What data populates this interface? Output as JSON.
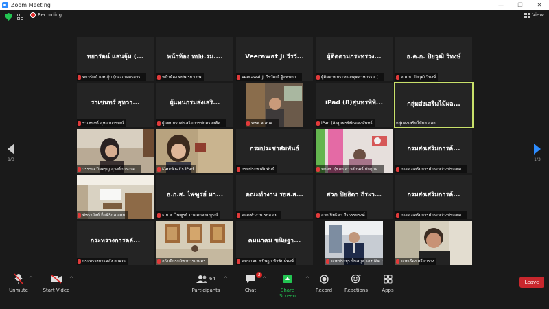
{
  "window": {
    "title": "Zoom Meeting",
    "minimize": "—",
    "maximize": "❐",
    "close": "✕"
  },
  "topbar": {
    "recording_label": "Recording",
    "view_label": "View"
  },
  "nav": {
    "prev_page": "1/3",
    "next_page": "1/3"
  },
  "tiles": [
    {
      "big": "ทยารัตน์ แสนจุ้ม (...",
      "caption": "ทยารัตน์ แสนจุ้ม (กองเกษตรสาร..."
    },
    {
      "big": "หน้าห้อง ทปษ.รม....",
      "caption": "หน้าห้อง ทปษ.รมว.กษ"
    },
    {
      "big": "Veerawat Ji วีรวั...",
      "caption": "Veerawat Ji วีรวัฒน์ ผู้แทนกา..."
    },
    {
      "big": "ผู้ติดตามกระทรวง...",
      "caption": "ผู้ติดตามกระทรวงอุตสาหกรรม (..."
    },
    {
      "big": "อ.ค.ก. ปิยวุฒิ วิทงษ์",
      "caption": "อ.ค.ก. ปิยวุฒิ วิทงษ์"
    },
    {
      "big": "ราเชนทร์ สุหวา...",
      "caption": "ราเชนทร์ สุหวานารมณ์"
    },
    {
      "big": "ผู้แทนกรมส่งเสริ...",
      "caption": "ผู้แทนกรมส่งเสริมการปกครองท้อ..."
    },
    {
      "big": "",
      "caption": "ทชพ.ศ.สนศ..."
    },
    {
      "big": "iPad (8)สุนทรพิพิ...",
      "caption": "iPad (8)สุนทรพิพิธแสงจันทร์"
    },
    {
      "big": "กลุ่มส่งเสริมไม้ผล...",
      "caption": "กลุ่มส่งเสริมไม้ผล สสจ."
    },
    {
      "big": "",
      "caption": "วรรรณ ปิดจรุญ สุวงค์การเกษ..."
    },
    {
      "big": "",
      "caption": "Kanokrat's iPad"
    },
    {
      "big": "กรมประชาสัมพันธ์",
      "caption": "กรมประชาสัมพันธ์"
    },
    {
      "big": "",
      "caption": "มกอช. (ชอก.สาวลักษณ์ ยักฤกษ..."
    },
    {
      "big": "กรมส่งเสริมการค้...",
      "caption": "กรมส่งเสริมการค้าระหว่างประเทศ..."
    },
    {
      "big": "",
      "caption": "พัชราวัลย์ ก็นศิริกุล สศก."
    },
    {
      "big": "ธ.ก.ส. ไพฑูรย์ มา...",
      "caption": "ธ.ก.ส. ไพฑูรย์ มาแตกจสมบูรณ์"
    },
    {
      "big": "คณะทำงาน รธส.ส...",
      "caption": "คณะทำงาน รธส.สม."
    },
    {
      "big": "สวก ปิยธิดา ถีระว...",
      "caption": "สวก ปิยธิดา ถีรธรรมรงค์"
    },
    {
      "big": "กรมส่งเสริมการค้...",
      "caption": "กรมส่งเสริมการค้าระหว่างประเทศ..."
    },
    {
      "big": "กระทรวงการคลั...",
      "caption": "กระทรวงการคลัง สาคุณ"
    },
    {
      "big": "",
      "caption": "อธิบดีกรมวิชาการเกษตร"
    },
    {
      "big": "คมนาคม ขนิษฐา...",
      "caption": "คมนาคม ขนิษฐา ห้าพันธ์พงษ์"
    },
    {
      "big": "",
      "caption": "นายประยุร ปั้นสกุล รองปลัด กษ."
    },
    {
      "big": "",
      "caption": "นายเรือง ศรีนาราง"
    }
  ],
  "toolbar": {
    "unmute": "Unmute",
    "start_video": "Start Video",
    "participants": "Participants",
    "participants_count": "64",
    "chat": "Chat",
    "chat_badge": "3",
    "share_screen": "Share Screen",
    "record": "Record",
    "reactions": "Reactions",
    "apps": "Apps",
    "leave": "Leave"
  },
  "colors": {
    "accent": "#2d8cff",
    "share": "#23c552",
    "leave": "#c8272d",
    "active_border": "#c8e06a",
    "shield": "#23c552"
  }
}
